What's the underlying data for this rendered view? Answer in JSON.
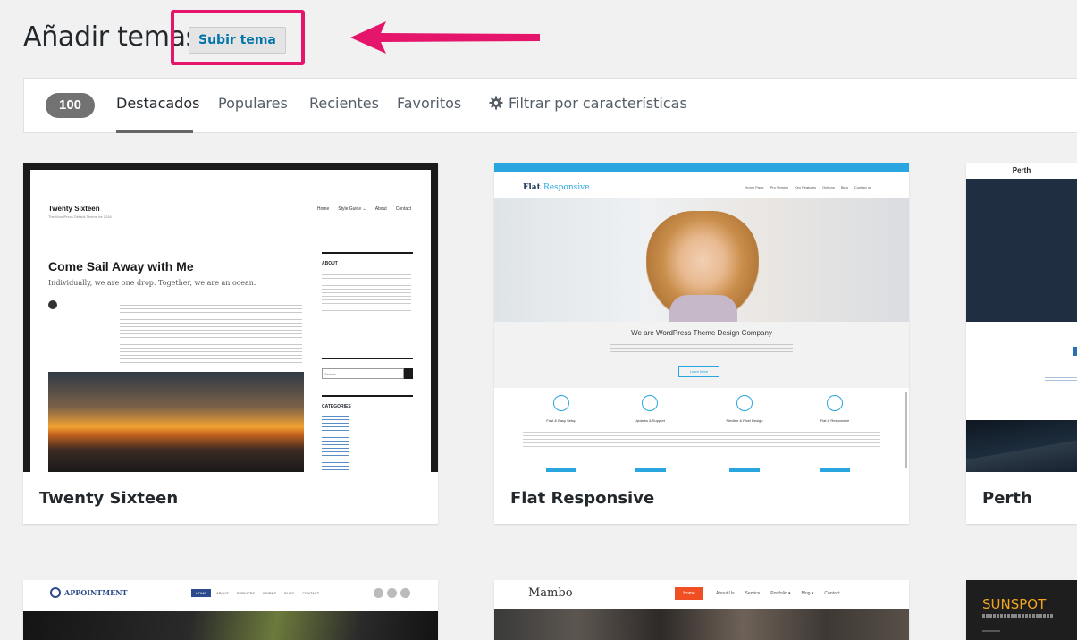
{
  "header": {
    "title": "Añadir temas",
    "upload_label": "Subir tema"
  },
  "filter": {
    "count": "100",
    "tabs": [
      {
        "label": "Destacados",
        "active": true
      },
      {
        "label": "Populares"
      },
      {
        "label": "Recientes"
      },
      {
        "label": "Favoritos"
      },
      {
        "label": "Filtrar por características",
        "icon": "gear-icon"
      }
    ]
  },
  "themes": [
    {
      "name": "Twenty Sixteen",
      "preview": {
        "site_title": "Twenty Sixteen",
        "site_tagline": "The WordPress Default Theme for 2016",
        "nav": [
          "Home",
          "Style Guide ⌄",
          "About",
          "Contact"
        ],
        "post_title": "Come Sail Away with Me",
        "post_subtitle": "Individually, we are one drop. Together, we are an ocean.",
        "sidebar_about": "ABOUT",
        "sidebar_search": "Search...",
        "sidebar_categories": "CATEGORIES"
      }
    },
    {
      "name": "Flat Responsive",
      "preview": {
        "logo_a": "Flat",
        "logo_b": "Responsive",
        "nav": [
          "Home Page",
          "Pro Version",
          "Key Features",
          "Options",
          "Blog",
          "Contact us"
        ],
        "headline": "We are WordPress Theme Design Company",
        "button": "Learn More",
        "features": [
          "Fast & Easy Setup",
          "Updates & Support",
          "Flexible & Pixel Design",
          "Flat & Responsive"
        ]
      }
    },
    {
      "name": "Perth",
      "preview": {
        "site_title": "Perth"
      }
    },
    {
      "name": "Appointment",
      "preview": {
        "logo": "APPOINTMENT",
        "nav": [
          "HOME",
          "ABOUT",
          "SERVICES",
          "WORKS",
          "BLOG",
          "CONTACT"
        ]
      }
    },
    {
      "name": "Mambo",
      "preview": {
        "logo": "Mambo",
        "nav": [
          "Home",
          "About Us",
          "Service",
          "Portfolio ▾",
          "Blog ▾",
          "Contact"
        ]
      }
    },
    {
      "name": "Sunspot",
      "preview": {
        "logo": "SUNSPOT"
      }
    }
  ],
  "colors": {
    "highlight": "#e5156b",
    "link": "#0073aa",
    "badge": "#727272",
    "flat_accent": "#29a6e0",
    "mambo_accent": "#f04e23"
  }
}
